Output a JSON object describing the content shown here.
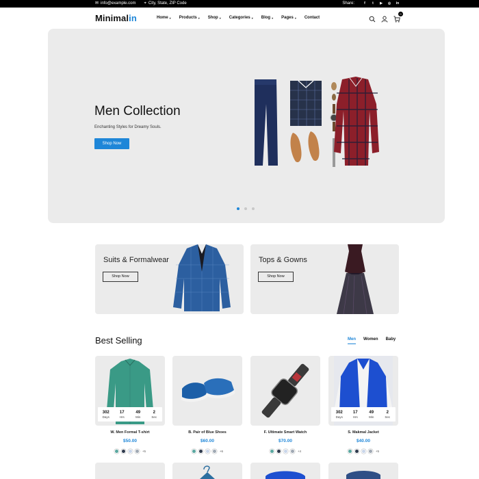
{
  "topbar": {
    "email": "info@example.com",
    "address": "City, State, ZIP Code",
    "share_label": "Share:",
    "socials": [
      "facebook-icon",
      "twitter-icon",
      "youtube-icon",
      "instagram-icon",
      "linkedin-icon"
    ]
  },
  "header": {
    "logo_main": "Minimal",
    "logo_accent": "in",
    "nav": [
      {
        "label": "Home",
        "dropdown": true
      },
      {
        "label": "Products",
        "dropdown": true
      },
      {
        "label": "Shop",
        "dropdown": true
      },
      {
        "label": "Categories",
        "dropdown": true
      },
      {
        "label": "Blog",
        "dropdown": true
      },
      {
        "label": "Pages",
        "dropdown": true
      },
      {
        "label": "Contact",
        "dropdown": false
      }
    ],
    "cart_count": "0"
  },
  "hero": {
    "title": "Men Collection",
    "subtitle": "Enchanting Styles for Dreamy Souls.",
    "button": "Shop Now",
    "slides": 3,
    "active_slide": 1
  },
  "categories": [
    {
      "title": "Suits & Formalwear",
      "button": "Shop Now"
    },
    {
      "title": "Tops & Gowns",
      "button": "Shop Now"
    }
  ],
  "best_selling": {
    "title": "Best Selling",
    "tabs": [
      "Men",
      "Women",
      "Baby"
    ],
    "active_tab": "Men",
    "products": [
      {
        "name": "W. Men Formal T-shirt",
        "price": "$50.00",
        "has_countdown": true,
        "countdown": {
          "days": "302",
          "hrs": "17",
          "min": "49",
          "sec": "2"
        },
        "swatches": [
          "#5aa7a0",
          "#2f3b4e",
          "#c9d6ea",
          "#9fa8b3"
        ],
        "more": "+5"
      },
      {
        "name": "B. Pair of Blue Shoes",
        "price": "$60.00",
        "has_countdown": false,
        "swatches": [
          "#5aa7a0",
          "#2f3b4e",
          "#c9d6ea",
          "#9fa8b3"
        ],
        "more": "+6"
      },
      {
        "name": "F. Ultimate Smart Watch",
        "price": "$70.00",
        "has_countdown": false,
        "swatches": [
          "#5aa7a0",
          "#2f3b4e",
          "#c9d6ea",
          "#9fa8b3"
        ],
        "more": "+4"
      },
      {
        "name": "S. Makmal Jacket",
        "price": "$40.00",
        "has_countdown": true,
        "countdown": {
          "days": "302",
          "hrs": "17",
          "min": "49",
          "sec": "2"
        },
        "swatches": [
          "#5aa7a0",
          "#2f3b4e",
          "#c9d6ea",
          "#9fa8b3"
        ],
        "more": "+5"
      }
    ],
    "countdown_labels": {
      "days": "Days",
      "hrs": "Hrs",
      "min": "Min",
      "sec": "Sec"
    }
  },
  "colors": {
    "accent": "#1e86d8",
    "panel": "#ebebeb"
  }
}
